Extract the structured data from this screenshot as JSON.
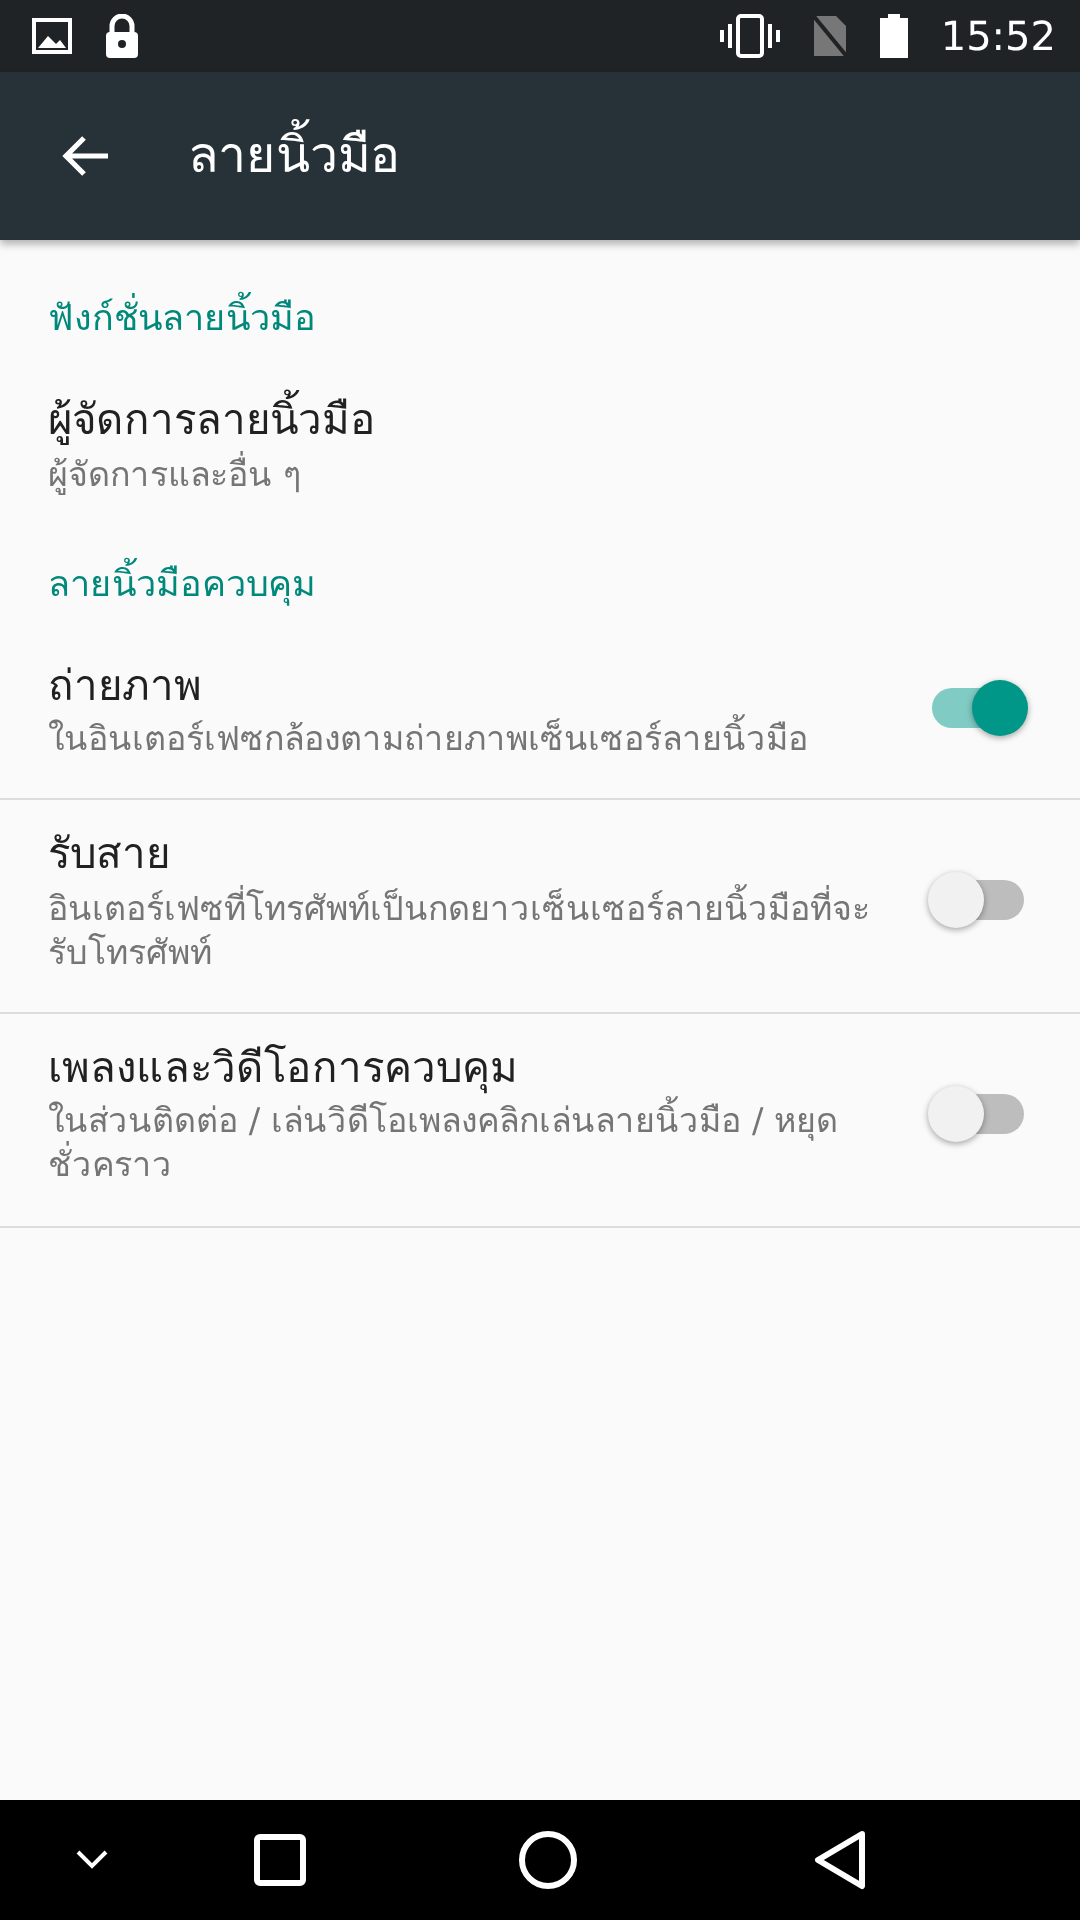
{
  "status_bar": {
    "time": "15:52"
  },
  "app_bar": {
    "title": "ลายนิ้วมือ"
  },
  "list": [
    {
      "kind": "section",
      "title": "ฟังก์ชั่นลายนิ้วมือ"
    },
    {
      "kind": "item",
      "title": "ผู้จัดการลายนิ้วมือ",
      "summary": "ผู้จัดการและอื่น ๆ"
    },
    {
      "kind": "section",
      "title": "ลายนิ้วมือควบคุม"
    },
    {
      "kind": "toggle",
      "title": "ถ่ายภาพ",
      "summary": "ในอินเตอร์เฟซกล้องตามถ่ายภาพเซ็นเซอร์ลายนิ้วมือ",
      "on": true
    },
    {
      "kind": "toggle",
      "title": "รับสาย",
      "summary": "อินเตอร์เฟซที่โทรศัพท์เป็นกดยาวเซ็นเซอร์ลายนิ้วมือที่จะรับโทรศัพท์",
      "on": false
    },
    {
      "kind": "toggle",
      "title": "เพลงและวิดีโอการควบคุม",
      "summary": "ในส่วนติดต่อ / เล่นวิดีโอเพลงคลิกเล่นลายนิ้วมือ / หยุดชั่วคราว",
      "on": false
    }
  ]
}
